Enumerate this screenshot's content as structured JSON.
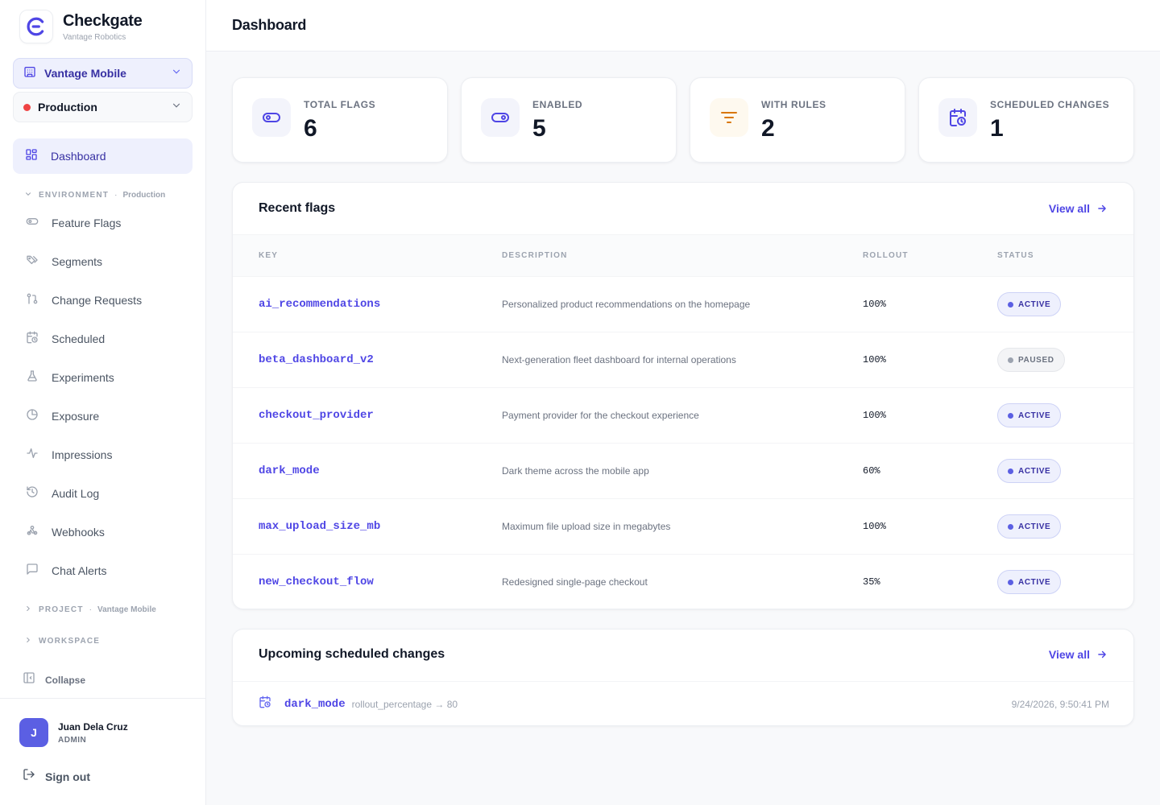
{
  "brand": {
    "name": "Checkgate",
    "org": "Vantage Robotics"
  },
  "project_selector": {
    "label": "Vantage Mobile"
  },
  "environment_selector": {
    "label": "Production"
  },
  "sidebar": {
    "active_item": {
      "label": "Dashboard"
    },
    "environment_section": {
      "title": "ENVIRONMENT",
      "context": "Production"
    },
    "items": [
      {
        "label": "Feature Flags",
        "icon": "toggle-icon"
      },
      {
        "label": "Segments",
        "icon": "tags-icon"
      },
      {
        "label": "Change Requests",
        "icon": "git-pull-request-icon"
      },
      {
        "label": "Scheduled",
        "icon": "calendar-clock-icon"
      },
      {
        "label": "Experiments",
        "icon": "flask-icon"
      },
      {
        "label": "Exposure",
        "icon": "pie-chart-icon"
      },
      {
        "label": "Impressions",
        "icon": "activity-icon"
      },
      {
        "label": "Audit Log",
        "icon": "history-icon"
      },
      {
        "label": "Webhooks",
        "icon": "webhook-icon"
      },
      {
        "label": "Chat Alerts",
        "icon": "message-square-icon"
      }
    ],
    "project_section": {
      "title": "PROJECT",
      "context": "Vantage Mobile"
    },
    "workspace_section": {
      "title": "WORKSPACE"
    },
    "collapse_label": "Collapse"
  },
  "user": {
    "initial": "J",
    "name": "Juan Dela Cruz",
    "role": "ADMIN"
  },
  "signout_label": "Sign out",
  "header": {
    "title": "Dashboard"
  },
  "stats": [
    {
      "label": "TOTAL FLAGS",
      "value": "6",
      "icon": "toggle-icon"
    },
    {
      "label": "ENABLED",
      "value": "5",
      "icon": "toggle-on-icon"
    },
    {
      "label": "WITH RULES",
      "value": "2",
      "icon": "filter-icon"
    },
    {
      "label": "SCHEDULED CHANGES",
      "value": "1",
      "icon": "calendar-clock-icon"
    }
  ],
  "recent_flags": {
    "title": "Recent flags",
    "view_all": "View all",
    "columns": {
      "key": "KEY",
      "description": "DESCRIPTION",
      "rollout": "ROLLOUT",
      "status": "STATUS"
    },
    "rows": [
      {
        "key": "ai_recommendations",
        "description": "Personalized product recommendations on the homepage",
        "rollout": "100%",
        "status": "ACTIVE"
      },
      {
        "key": "beta_dashboard_v2",
        "description": "Next-generation fleet dashboard for internal operations",
        "rollout": "100%",
        "status": "PAUSED"
      },
      {
        "key": "checkout_provider",
        "description": "Payment provider for the checkout experience",
        "rollout": "100%",
        "status": "ACTIVE"
      },
      {
        "key": "dark_mode",
        "description": "Dark theme across the mobile app",
        "rollout": "60%",
        "status": "ACTIVE"
      },
      {
        "key": "max_upload_size_mb",
        "description": "Maximum file upload size in megabytes",
        "rollout": "100%",
        "status": "ACTIVE"
      },
      {
        "key": "new_checkout_flow",
        "description": "Redesigned single-page checkout",
        "rollout": "35%",
        "status": "ACTIVE"
      }
    ]
  },
  "scheduled": {
    "title": "Upcoming scheduled changes",
    "view_all": "View all",
    "items": [
      {
        "key": "dark_mode",
        "detail": "rollout_percentage → 80",
        "time": "9/24/2026, 9:50:41 PM"
      }
    ]
  },
  "colors": {
    "accent": "#4f46e5",
    "accent_bg": "#eef0fd",
    "env_production": "#ef4444",
    "amber": "#d97706"
  }
}
